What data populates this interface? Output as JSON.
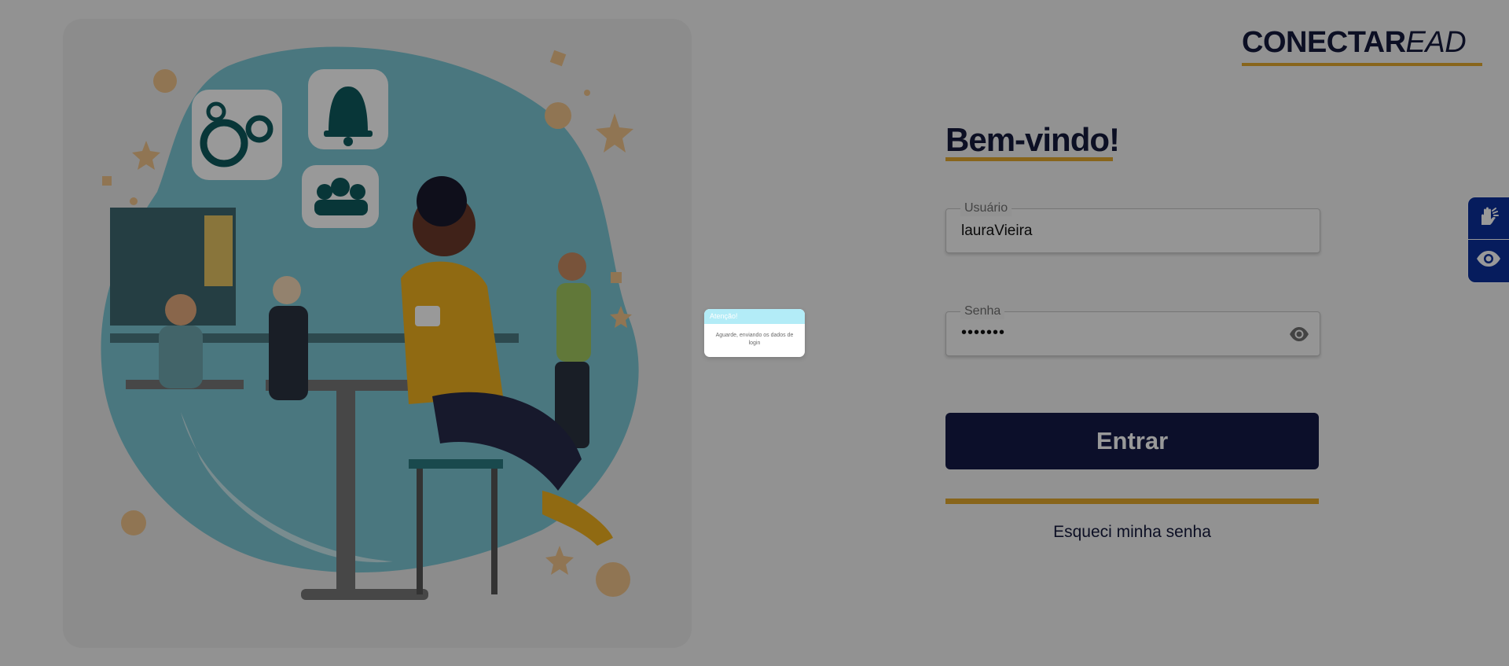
{
  "logo": {
    "brand_strong": "CONECTAR",
    "brand_light": "EAD"
  },
  "form": {
    "heading": "Bem-vindo!",
    "username": {
      "label": "Usuário",
      "value": "lauraVieira"
    },
    "password": {
      "label": "Senha",
      "value": "•••••••"
    },
    "submit_label": "Entrar",
    "forgot_label": "Esqueci minha senha"
  },
  "toast": {
    "title": "Atenção!",
    "message": "Aguarde, enviando os dados de login"
  },
  "icons": {
    "password_toggle": "eye-icon",
    "accessibility": [
      "sign-language-icon",
      "eye-icon"
    ]
  },
  "colors": {
    "brand_navy": "#141a46",
    "accent_gold": "#e3a82d",
    "accessibility_blue": "#0b2f9c",
    "toast_header": "#b3ecf7"
  }
}
